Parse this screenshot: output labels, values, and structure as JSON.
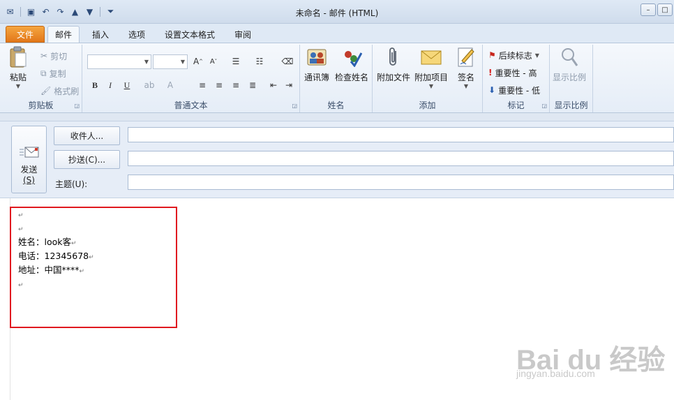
{
  "window": {
    "title": "未命名 - 邮件 (HTML)",
    "min_glyph": "–",
    "max_glyph": "□"
  },
  "tabs": [
    {
      "label": "文件"
    },
    {
      "label": "邮件"
    },
    {
      "label": "插入"
    },
    {
      "label": "选项"
    },
    {
      "label": "设置文本格式"
    },
    {
      "label": "审阅"
    }
  ],
  "ribbon": {
    "clipboard": {
      "label": "剪贴板",
      "paste": "粘贴",
      "cut": "剪切",
      "copy": "复制",
      "format_painter": "格式刷"
    },
    "basic_text": {
      "label": "普通文本",
      "bold": "B",
      "italic": "I",
      "underline": "U"
    },
    "names": {
      "label": "姓名",
      "address_book": "通讯簿",
      "check_names": "检查姓名"
    },
    "include": {
      "label": "添加",
      "attach_file": "附加文件",
      "attach_item": "附加项目",
      "signature": "签名"
    },
    "tags": {
      "label": "标记",
      "follow_up": "后续标志",
      "high_importance": "重要性 - 高",
      "low_importance": "重要性 - 低"
    },
    "zoom": {
      "label": "显示比例",
      "zoom": "显示比例"
    }
  },
  "header": {
    "send": "发送",
    "send_key": "(S)",
    "to_button": "收件人...",
    "cc_button": "抄送(C)...",
    "subject_label": "主题(U):",
    "to_value": "",
    "cc_value": "",
    "subject_value": ""
  },
  "body": {
    "lines": [
      "",
      "",
      "姓名：look客",
      "电话：12345678",
      "地址：中国****",
      ""
    ],
    "paragraph_mark": "↵"
  },
  "watermark": {
    "logo": "Bai du 经验",
    "url": "jingyan.baidu.com"
  },
  "colors": {
    "file_tab": "#e2771a",
    "highlight_border": "#e0191f",
    "ribbon_bg": "#e5edf7"
  }
}
